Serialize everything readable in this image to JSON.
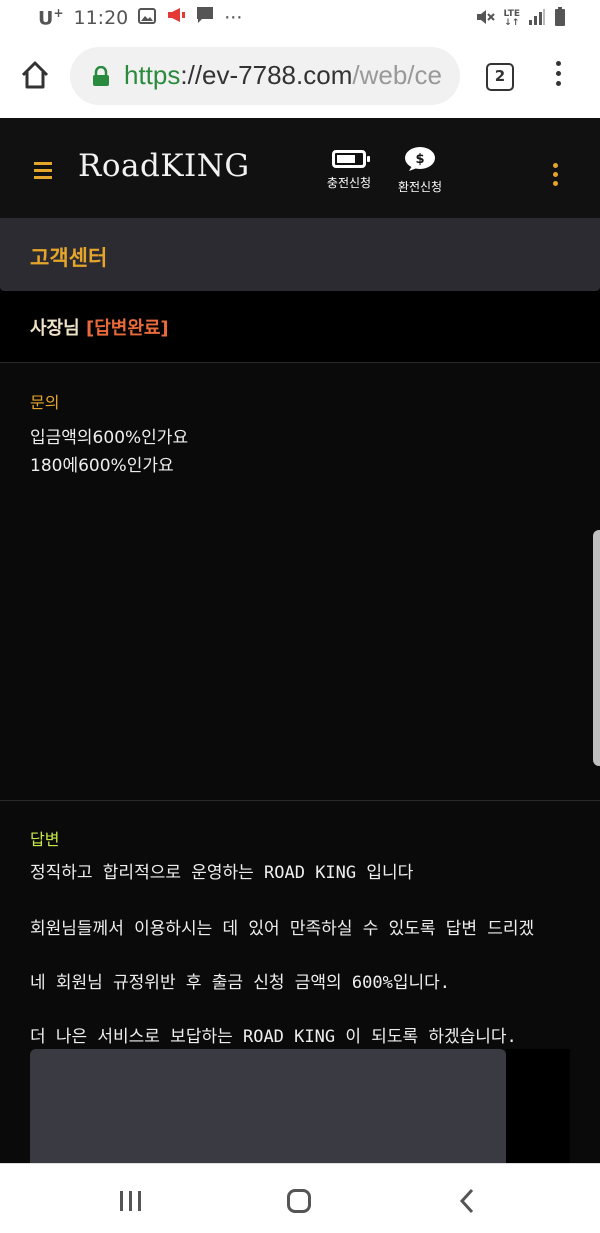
{
  "status_bar": {
    "carrier": "U",
    "carrier_sup": "+",
    "time": "11:20",
    "more": "···",
    "network": "LTE",
    "icons": [
      "image-icon",
      "megaphone-icon",
      "message-icon",
      "mute-icon",
      "signal-icon",
      "battery-icon"
    ]
  },
  "browser": {
    "url_scheme": "https",
    "url_rest": "://ev-7788.com",
    "url_path": "/web/ce",
    "tab_count": "2"
  },
  "app": {
    "logo": "RoadKING",
    "charge_label": "충전신청",
    "exchange_label": "환전신청",
    "accent_color": "#e5a52a"
  },
  "page": {
    "title": "고객센터",
    "subject_name": "사장님",
    "subject_status": "[답변완료]"
  },
  "question": {
    "label": "문의",
    "lines": [
      "입금액의600%인가요",
      "180에600%인가요"
    ]
  },
  "answer": {
    "label": "답변",
    "lines": [
      "정직하고 합리적으로 운영하는 ROAD KING 입니다",
      "회원님들께서 이용하시는 데 있어 만족하실 수 있도록 답변 드리겠",
      "네 회원님 규정위반 후 출금 신청 금액의 600%입니다.",
      "더 나은 서비스로 보답하는 ROAD KING 이 되도록 하겠습니다."
    ]
  }
}
